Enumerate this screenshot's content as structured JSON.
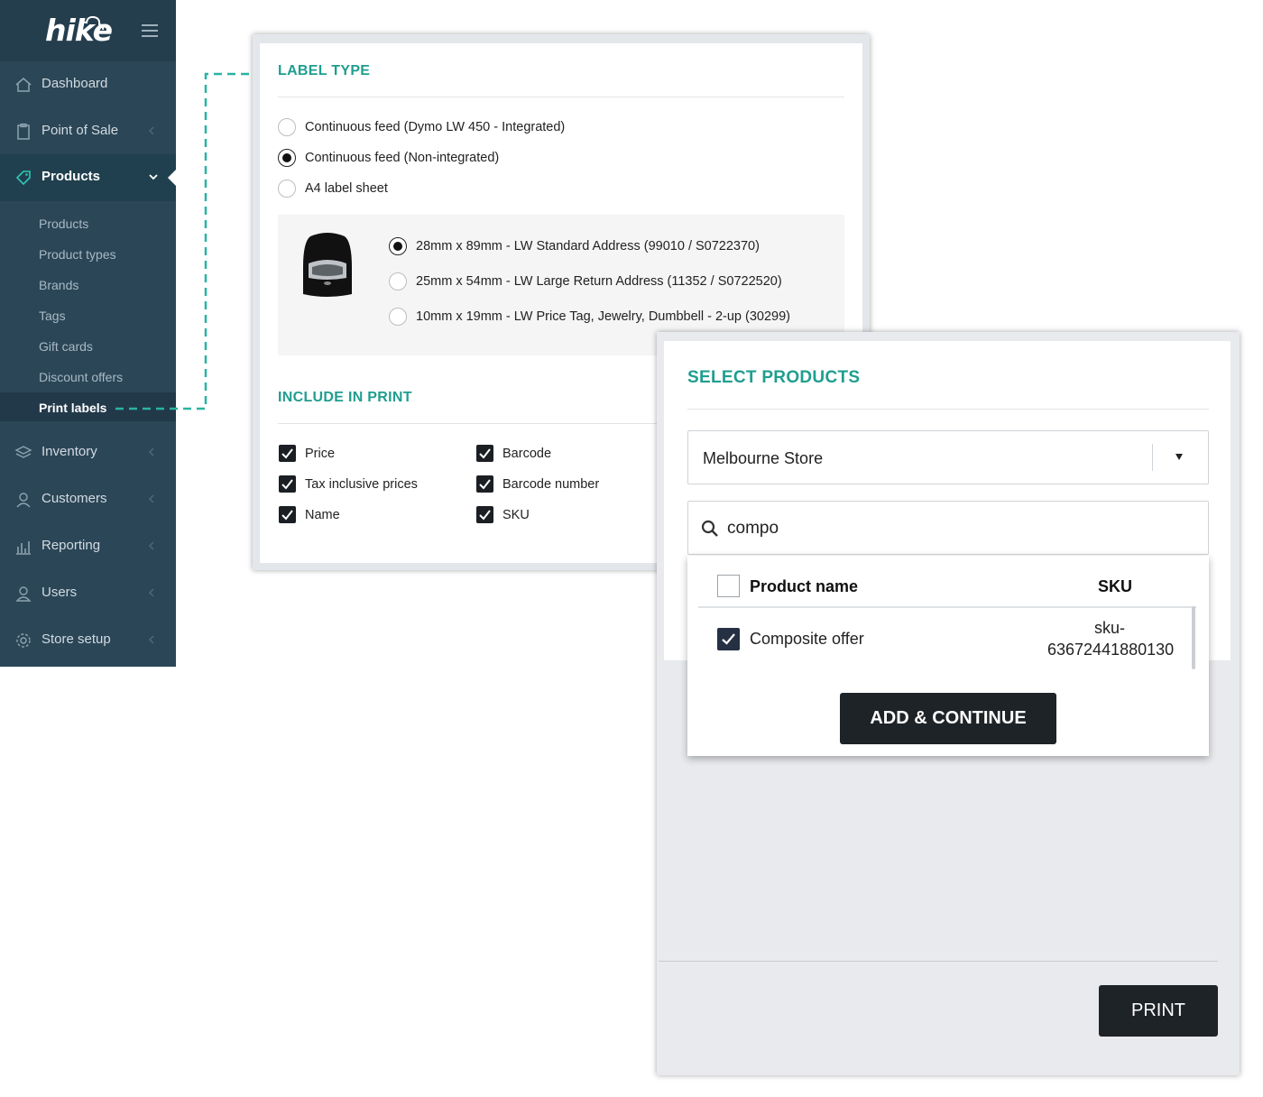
{
  "app": {
    "logo": "hike"
  },
  "sidebar": {
    "items": [
      {
        "label": "Dashboard",
        "icon": "home-icon"
      },
      {
        "label": "Point of Sale",
        "icon": "clipboard-icon"
      },
      {
        "label": "Products",
        "icon": "tag-icon"
      },
      {
        "label": "Inventory",
        "icon": "layers-icon"
      },
      {
        "label": "Customers",
        "icon": "person-icon"
      },
      {
        "label": "Reporting",
        "icon": "bar-chart-icon"
      },
      {
        "label": "Users",
        "icon": "user-icon"
      },
      {
        "label": "Store setup",
        "icon": "gear-icon"
      }
    ],
    "products_sub": [
      "Products",
      "Product types",
      "Brands",
      "Tags",
      "Gift cards",
      "Discount offers",
      "Print labels"
    ]
  },
  "label_type": {
    "title": "LABEL TYPE",
    "options": [
      "Continuous feed (Dymo LW 450 - Integrated)",
      "Continuous feed (Non-integrated)",
      "A4 label sheet"
    ],
    "selected_option": 1,
    "sizes": [
      "28mm x 89mm - LW Standard Address (99010 / S0722370)",
      "25mm x 54mm - LW Large Return Address (11352 / S0722520)",
      "10mm x 19mm - LW Price Tag, Jewelry, Dumbbell - 2-up (30299)"
    ],
    "selected_size": 0
  },
  "include_in_print": {
    "title": "INCLUDE IN PRINT",
    "col1": [
      "Price",
      "Tax inclusive prices",
      "Name"
    ],
    "col2": [
      "Barcode",
      "Barcode number",
      "SKU"
    ]
  },
  "select_products": {
    "title": "SELECT PRODUCTS",
    "store": "Melbourne Store",
    "search_value": "compo",
    "table": {
      "headers": {
        "name": "Product name",
        "sku": "SKU"
      },
      "rows": [
        {
          "name": "Composite offer",
          "sku_line1": "sku-",
          "sku_line2": "63672441880130",
          "checked": true
        }
      ]
    },
    "add_button": "ADD & CONTINUE",
    "print_button": "PRINT"
  },
  "colors": {
    "accent": "#1f9e8f",
    "sidebar": "#2b4657",
    "button": "#1e2328"
  }
}
